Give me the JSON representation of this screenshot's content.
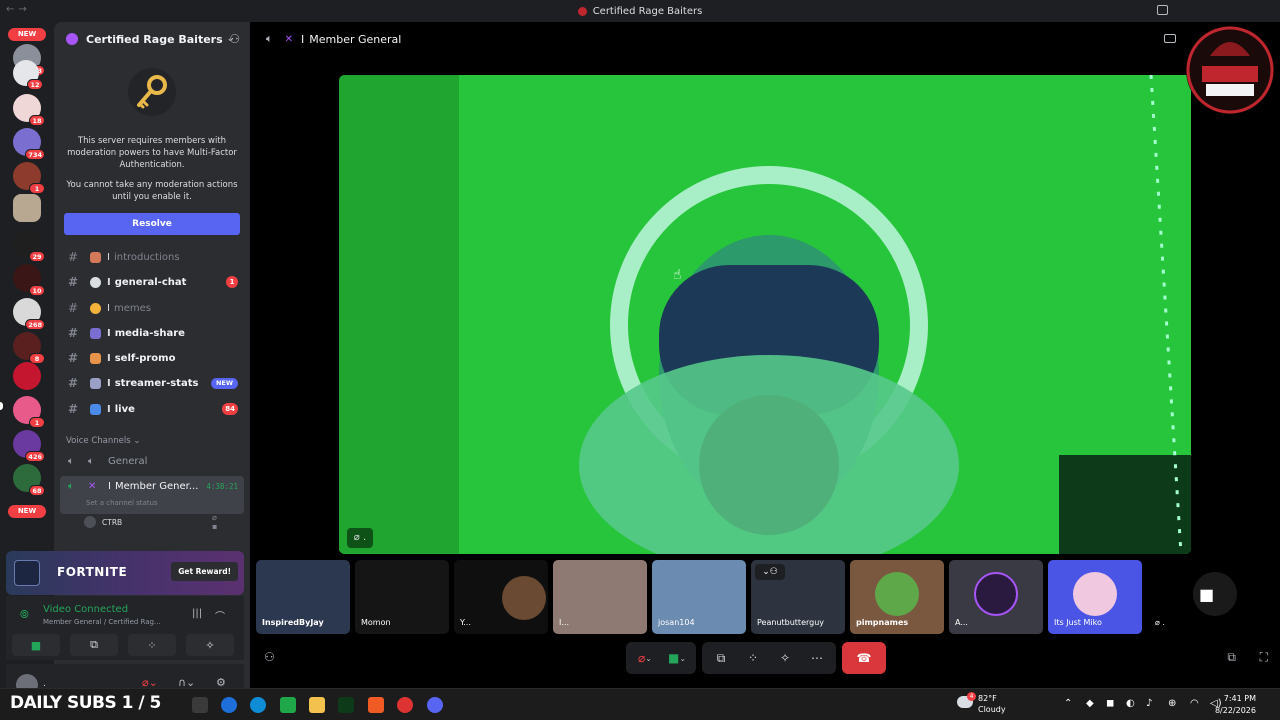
{
  "window": {
    "title": "Certified Rage Baiters"
  },
  "rail": {
    "new_label": "NEW",
    "badges": [
      "263",
      "12",
      "18",
      "734",
      "1",
      "29",
      "10",
      "268",
      "8",
      "1",
      "426",
      "68"
    ]
  },
  "server": {
    "name": "Certified Rage Baiters",
    "mfa_message": "This server requires members with moderation powers to have Multi-Factor Authentication.",
    "mfa_note": "You cannot take any moderation actions until you enable it.",
    "resolve_label": "Resolve"
  },
  "channels": [
    {
      "name": "introductions",
      "unread": false,
      "badge": ""
    },
    {
      "name": "general-chat",
      "unread": true,
      "badge": "1"
    },
    {
      "name": "memes",
      "unread": false,
      "badge": ""
    },
    {
      "name": "media-share",
      "unread": true,
      "badge": ""
    },
    {
      "name": "self-promo",
      "unread": true,
      "badge": ""
    },
    {
      "name": "streamer-stats",
      "unread": true,
      "badge": "NEW"
    },
    {
      "name": "live",
      "unread": true,
      "badge": "84"
    }
  ],
  "channel_prefix": "I",
  "voice": {
    "category": "Voice Channels",
    "channels": [
      {
        "name": "General"
      },
      {
        "name": "Member Gener...",
        "timer": "4:38:21",
        "status": "Set a channel status"
      }
    ],
    "member": "CTRB"
  },
  "promo": {
    "logo": "FORTNITE",
    "button": "Get Reward!"
  },
  "voice_panel": {
    "status": "Video Connected",
    "location": "Member General / Certified Rag..."
  },
  "user": {
    "name": "."
  },
  "header": {
    "channel": "Member General"
  },
  "tiles": [
    {
      "name": "InspiredByJay",
      "color": "#2c3850"
    },
    {
      "name": "Momon",
      "color": "#151515"
    },
    {
      "name": "Y...",
      "color": "#101010"
    },
    {
      "name": "I...",
      "color": "#8e7a72"
    },
    {
      "name": "josan104",
      "color": "#6c8bb0"
    },
    {
      "name": "Peanutbutterguy",
      "color": "#2d3440"
    },
    {
      "name": "pimpnames",
      "color": "#7a5840"
    },
    {
      "name": "A...",
      "color": "#3a3a44"
    },
    {
      "name": "Its Just Miko",
      "color": "#4a55e6"
    },
    {
      "name": "",
      "color": "#000000"
    }
  ],
  "taskbar": {
    "overlay_text": "DAILY SUBS 1 / 5",
    "temperature": "82°F",
    "condition": "Cloudy",
    "weather_badge": "4",
    "time": "7:41 PM",
    "date": "8/22/2026"
  },
  "colors": {
    "accent": "#5865f2",
    "danger": "#f23f43",
    "connected": "#23a55a",
    "video_bg": "#22c63a"
  }
}
